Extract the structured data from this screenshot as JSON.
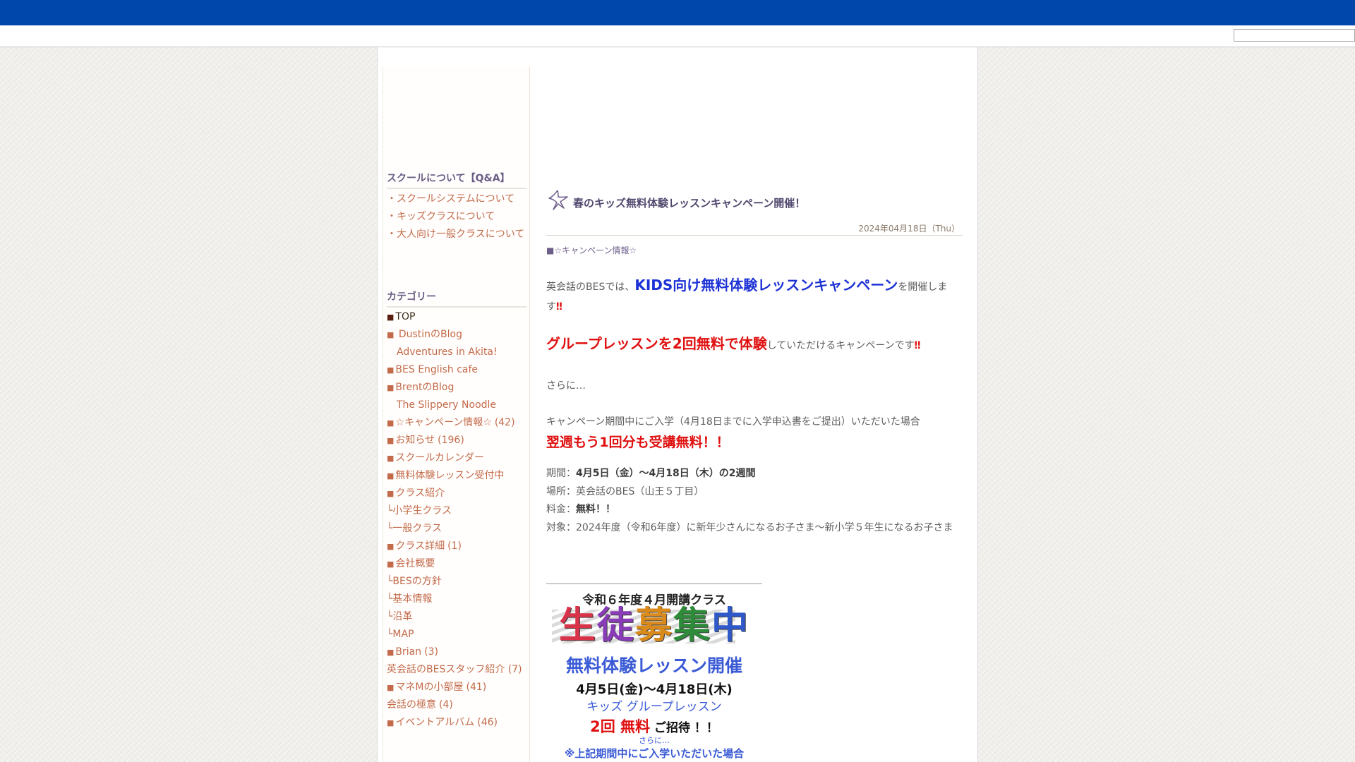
{
  "sidebar": {
    "heading_school": "スクールについて【Q&A】",
    "school_links": [
      "・スクールシステムについて",
      "・キッズクラスについて",
      "・大人向け一般クラスについて"
    ],
    "heading_category": "カテゴリー",
    "categories": [
      {
        "sq": "■",
        "label": "TOP",
        "count": ""
      },
      {
        "sq": "■",
        "label": " DustinのBlog",
        "count": ""
      },
      {
        "sq": "",
        "label": "Adventures in Akita!",
        "count": ""
      },
      {
        "sq": "■",
        "label": "BES English cafe",
        "count": ""
      },
      {
        "sq": "■",
        "label": "BrentのBlog",
        "count": ""
      },
      {
        "sq": "",
        "label": "The Slippery Noodle",
        "count": ""
      },
      {
        "sq": "■",
        "label": "☆キャンペーン情報☆",
        "count": "(42)"
      },
      {
        "sq": "■",
        "label": "お知らせ",
        "count": "(196)"
      },
      {
        "sq": "■",
        "label": "スクールカレンダー",
        "count": ""
      },
      {
        "sq": "■",
        "label": "無料体験レッスン受付中",
        "count": ""
      },
      {
        "sq": "■",
        "label": "クラス紹介",
        "count": ""
      },
      {
        "sq": "",
        "label": "└小学生クラス",
        "count": ""
      },
      {
        "sq": "",
        "label": "└一般クラス",
        "count": ""
      },
      {
        "sq": "■",
        "label": "クラス詳細",
        "count": "(1)"
      },
      {
        "sq": "■",
        "label": "会社概要",
        "count": ""
      },
      {
        "sq": "",
        "label": "└BESの方針",
        "count": ""
      },
      {
        "sq": "",
        "label": "└基本情報",
        "count": ""
      },
      {
        "sq": "",
        "label": "└沿革",
        "count": ""
      },
      {
        "sq": "",
        "label": "└MAP",
        "count": ""
      },
      {
        "sq": "■",
        "label": "Brian",
        "count": "(3)"
      },
      {
        "sq": "",
        "label": "英会話のBESスタッフ紹介 (7)",
        "count": ""
      },
      {
        "sq": "■",
        "label": "マネMの小部屋",
        "count": "(41)"
      },
      {
        "sq": "",
        "label": "会話の極意",
        "count": "(4)"
      },
      {
        "sq": "■",
        "label": "イベントアルバム",
        "count": "(46)"
      }
    ]
  },
  "post": {
    "title": "春のキッズ無料体験レッスンキャンペーン開催！",
    "date": "2024年04月18日（Thu）",
    "category": "■☆キャンペーン情報☆",
    "p1_prefix": "英会話のBESでは、",
    "p1_em": "KIDS向け無料体験レッスンキャンペーン",
    "p1_suffix": "を開催します",
    "p1_mark": "‼",
    "p2_em": "グループレッスンを2回無料で体験",
    "p2_suffix": "していただけるキャンペーンです",
    "p2_mark": "‼",
    "p3": "さらに…",
    "p4": "キャンペーン期間中にご入学（4月18日までに入学申込書をご提出）いただいた場合",
    "p5": "翌週もう1回分も受講無料！！",
    "period_label": "期間：",
    "period_value": "4月5日（金）～4月18日（木）",
    "period_suffix": "の2週間",
    "place": "場所：英会話のBES（山王５丁目）",
    "fee_label": "料金：",
    "fee_value": "無料！！",
    "target": "対象：2024年度（令和6年度）に新年少さんになるお子さま～新小学５年生になるお子さま"
  },
  "flyer": {
    "line1": "令和６年度４月開講クラス",
    "line2_chars": [
      "生",
      "徒",
      "募",
      "集",
      "中"
    ],
    "line3": "無料体験レッスン開催",
    "line4": "4月5日(金)～4月18日(木)",
    "line5": "キッズ グループレッスン",
    "line6_red": "2回 無料",
    "line6_suffix": " ご招待 ！！",
    "line7": "さらに…",
    "line8": "※上記期間中にご入学いただいた場合"
  },
  "colors": {
    "topbar": "#0047ab",
    "link": "#c36a4a",
    "heading": "#6b5d86",
    "emphasis_blue": "#1d32d6",
    "emphasis_red": "#e01010"
  }
}
